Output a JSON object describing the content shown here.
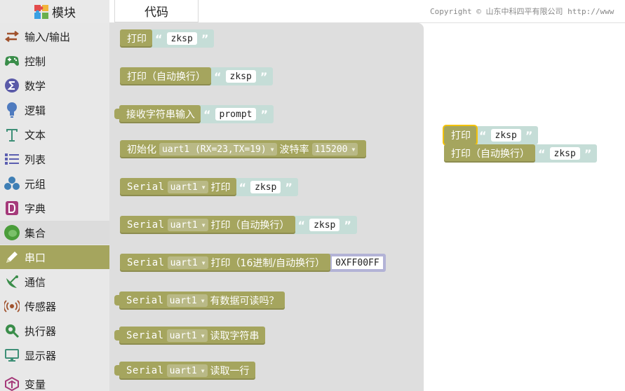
{
  "tabs": {
    "blocks": "模块",
    "code": "代码"
  },
  "copyright": "Copyright © 山东中科四平有限公司 http://www",
  "sidebar": {
    "items": [
      {
        "label": "输入/输出",
        "icon": "input-output-icon",
        "color": "#a0522d"
      },
      {
        "label": "控制",
        "icon": "gamepad-icon",
        "color": "#3a8d4a"
      },
      {
        "label": "数学",
        "icon": "math-icon",
        "color": "#5a5aa8"
      },
      {
        "label": "逻辑",
        "icon": "lightbulb-icon",
        "color": "#4f7bbf"
      },
      {
        "label": "文本",
        "icon": "text-icon",
        "color": "#3e8f77"
      },
      {
        "label": "列表",
        "icon": "list-icon",
        "color": "#5c5fb0"
      },
      {
        "label": "元组",
        "icon": "tuple-icon",
        "color": "#3f7fb5"
      },
      {
        "label": "字典",
        "icon": "dictionary-icon",
        "color": "#a53a7a"
      },
      {
        "label": "集合",
        "icon": "set-icon",
        "color": "#4a9d3a"
      },
      {
        "label": "串口",
        "icon": "pen-icon",
        "color": "#ffffff"
      },
      {
        "label": "通信",
        "icon": "satellite-icon",
        "color": "#3a8d4a"
      },
      {
        "label": "传感器",
        "icon": "sensor-icon",
        "color": "#a0522d"
      },
      {
        "label": "执行器",
        "icon": "actuator-icon",
        "color": "#3a8d4a"
      },
      {
        "label": "显示器",
        "icon": "monitor-icon",
        "color": "#3e8f77"
      },
      {
        "label": "变量",
        "icon": "variable-icon",
        "color": "#a53a7a"
      }
    ],
    "selected_index": 9
  },
  "flyout": {
    "print": {
      "label": "打印",
      "value": "zksp"
    },
    "println": {
      "label": "打印（自动换行）",
      "value": "zksp"
    },
    "input": {
      "label": "接收字符串输入",
      "value": "prompt"
    },
    "init": {
      "label": "初始化",
      "port": "uart1 (RX=23,TX=19)",
      "baud_label": "波特率",
      "baud": "115200"
    },
    "serial_word": "Serial",
    "port": "uart1",
    "s_print": {
      "label": "打印",
      "value": "zksp"
    },
    "s_println": {
      "label": "打印（自动换行）",
      "value": "zksp"
    },
    "s_hex": {
      "label": "打印（16进制/自动换行）",
      "value": "0XFF00FF"
    },
    "s_available": {
      "label": "有数据可读吗？"
    },
    "s_readstr": {
      "label": "读取字符串"
    },
    "s_readline": {
      "label": "读取一行"
    }
  },
  "workspace": {
    "print": {
      "label": "打印",
      "value": "zksp"
    },
    "println": {
      "label": "打印（自动换行）",
      "value": "zksp"
    }
  },
  "colors": {
    "block": "#a5a55e",
    "string": "#c5ddd7",
    "hex": "#b3b3d6",
    "selected_outline": "#f3c20b"
  }
}
